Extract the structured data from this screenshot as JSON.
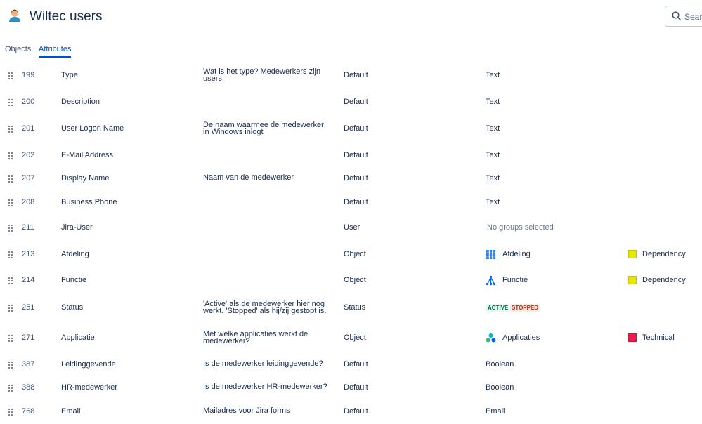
{
  "header": {
    "title": "Wiltec users",
    "search_placeholder": "Searc"
  },
  "tabs": [
    "Objects",
    "Attributes"
  ],
  "colors": {
    "accent": "#0052cc",
    "dependency": "#e5e70b",
    "technical": "#ea1c4b"
  },
  "rows": [
    {
      "id": "199",
      "name": "Type",
      "desc1": "Wat is het type? Medewerkers zijn",
      "desc2": "users.",
      "type": "Default",
      "config": "Text"
    },
    {
      "id": "200",
      "name": "Description",
      "desc1": "",
      "desc2": "",
      "type": "Default",
      "config": "Text"
    },
    {
      "id": "201",
      "name": "User Logon Name",
      "desc1": "De naam waarmee de medewerker",
      "desc2": "in Windows inlogt",
      "type": "Default",
      "config": "Text"
    },
    {
      "id": "202",
      "name": "E-Mail Address",
      "desc1": "",
      "desc2": "",
      "type": "Default",
      "config": "Text"
    },
    {
      "id": "207",
      "name": "Display Name",
      "desc1": "Naam van de medewerker",
      "desc2": "",
      "type": "Default",
      "config": "Text"
    },
    {
      "id": "208",
      "name": "Business Phone",
      "desc1": "",
      "desc2": "",
      "type": "Default",
      "config": "Text"
    },
    {
      "id": "211",
      "name": "Jira-User",
      "desc1": "",
      "desc2": "",
      "type": "User",
      "config": "No groups selected"
    },
    {
      "id": "213",
      "name": "Afdeling",
      "desc1": "",
      "desc2": "",
      "type": "Object",
      "object_type": "Afdeling",
      "object_icon": "grid-icon",
      "ref": "Dependency",
      "ref_color": "#e5e70b"
    },
    {
      "id": "214",
      "name": "Functie",
      "desc1": "",
      "desc2": "",
      "type": "Object",
      "object_type": "Functie",
      "object_icon": "org-chart-icon",
      "ref": "Dependency",
      "ref_color": "#e5e70b"
    },
    {
      "id": "251",
      "name": "Status",
      "desc1": "'Active' als de medewerker hier nog",
      "desc2": "werkt. 'Stopped' als hij/zij gestopt is.",
      "type": "Status",
      "status_values": [
        "ACTIVE",
        "STOPPED"
      ]
    },
    {
      "id": "271",
      "name": "Applicatie",
      "desc1": "Met welke applicaties werkt de",
      "desc2": "medewerker?",
      "type": "Object",
      "object_type": "Applicaties",
      "object_icon": "apps-icon",
      "ref": "Technical",
      "ref_color": "#ea1c4b"
    },
    {
      "id": "387",
      "name": "Leidinggevende",
      "desc1": "Is de medewerker leidinggevende?",
      "desc2": "",
      "type": "Default",
      "config": "Boolean"
    },
    {
      "id": "388",
      "name": "HR-medewerker",
      "desc1": "Is de medewerker HR-medewerker?",
      "desc2": "",
      "type": "Default",
      "config": "Boolean"
    },
    {
      "id": "768",
      "name": "Email",
      "desc1": "Mailadres voor Jira forms",
      "desc2": "",
      "type": "Default",
      "config": "Email"
    }
  ]
}
